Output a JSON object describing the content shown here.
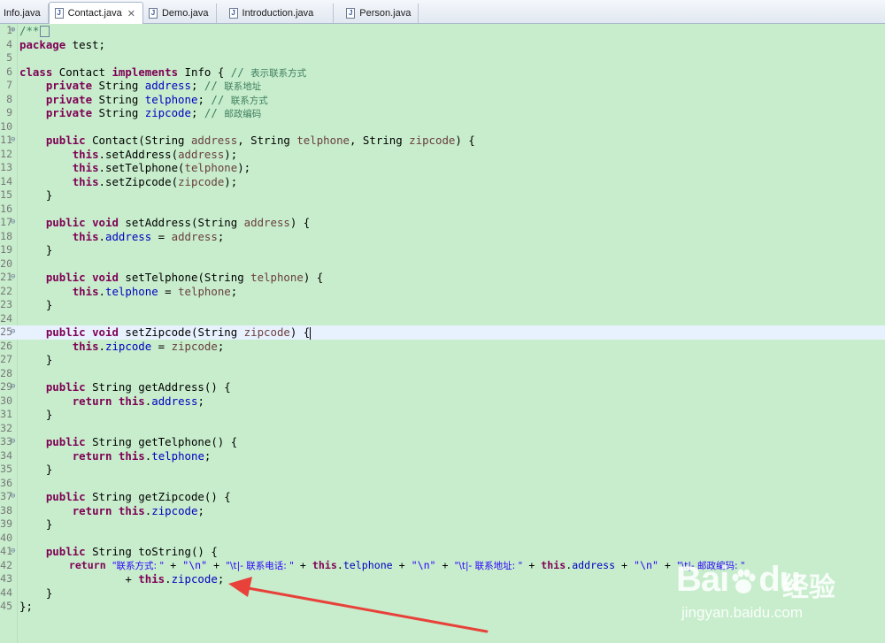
{
  "tabs": [
    {
      "label": "Info.java",
      "active": false
    },
    {
      "label": "Contact.java",
      "active": true,
      "close": "✕"
    },
    {
      "label": "Demo.java",
      "active": false
    },
    {
      "label": "Introduction.java",
      "active": false
    },
    {
      "label": "Person.java",
      "active": false
    }
  ],
  "line_numbers": [
    "1",
    "4",
    "5",
    "6",
    "7",
    "8",
    "9",
    "10",
    "11",
    "12",
    "13",
    "14",
    "15",
    "16",
    "17",
    "18",
    "19",
    "20",
    "21",
    "22",
    "23",
    "24",
    "25",
    "26",
    "27",
    "28",
    "29",
    "30",
    "31",
    "32",
    "33",
    "34",
    "35",
    "36",
    "37",
    "38",
    "39",
    "40",
    "41",
    "42",
    "43",
    "44",
    "45"
  ],
  "code": {
    "l1": "/**",
    "l4_kw": "package",
    "l4_rest": " test;",
    "l6_kw1": "class",
    "l6_t1": " Contact ",
    "l6_kw2": "implements",
    "l6_t2": " Info { ",
    "l6_cm": "// ",
    "l6_cmcn": "表示联系方式",
    "l7_kw": "private",
    "l7_t": " String ",
    "l7_f": "address",
    "l7_e": "; ",
    "l7_cm": "// ",
    "l7_cmcn": "联系地址",
    "l8_kw": "private",
    "l8_t": " String ",
    "l8_f": "telphone",
    "l8_e": "; ",
    "l8_cm": "// ",
    "l8_cmcn": "联系方式",
    "l9_kw": "private",
    "l9_t": " String ",
    "l9_f": "zipcode",
    "l9_e": "; ",
    "l9_cm": "// ",
    "l9_cmcn": "邮政编码",
    "l11_kw": "public",
    "l11_t1": " Contact(String ",
    "l11_p1": "address",
    "l11_t2": ", String ",
    "l11_p2": "telphone",
    "l11_t3": ", String ",
    "l11_p3": "zipcode",
    "l11_t4": ") {",
    "l12_kw": "this",
    "l12_t1": ".setAddress(",
    "l12_p": "address",
    "l12_t2": ");",
    "l13_kw": "this",
    "l13_t1": ".setTelphone(",
    "l13_p": "telphone",
    "l13_t2": ");",
    "l14_kw": "this",
    "l14_t1": ".setZipcode(",
    "l14_p": "zipcode",
    "l14_t2": ");",
    "close": "}",
    "l17_kw1": "public",
    "l17_kw2": "void",
    "l17_t1": " setAddress(String ",
    "l17_p": "address",
    "l17_t2": ") {",
    "l18_kw": "this",
    "l18_d": ".",
    "l18_f": "address",
    "l18_t": " = ",
    "l18_p": "address",
    "l18_e": ";",
    "l21_kw1": "public",
    "l21_kw2": "void",
    "l21_t1": " setTelphone(String ",
    "l21_p": "telphone",
    "l21_t2": ") {",
    "l22_kw": "this",
    "l22_d": ".",
    "l22_f": "telphone",
    "l22_t": " = ",
    "l22_p": "telphone",
    "l22_e": ";",
    "l25_kw1": "public",
    "l25_kw2": "void",
    "l25_t1": " setZipcode(String ",
    "l25_p": "zipcode",
    "l25_t2": ") {",
    "l26_kw": "this",
    "l26_d": ".",
    "l26_f": "zipcode",
    "l26_t": " = ",
    "l26_p": "zipcode",
    "l26_e": ";",
    "l29_kw": "public",
    "l29_t": " String getAddress() {",
    "l30_kw1": "return",
    "l30_kw2": "this",
    "l30_d": ".",
    "l30_f": "address",
    "l30_e": ";",
    "l33_kw": "public",
    "l33_t": " String getTelphone() {",
    "l34_kw1": "return",
    "l34_kw2": "this",
    "l34_d": ".",
    "l34_f": "telphone",
    "l34_e": ";",
    "l37_kw": "public",
    "l37_t": " String getZipcode() {",
    "l38_kw1": "return",
    "l38_kw2": "this",
    "l38_d": ".",
    "l38_f": "zipcode",
    "l38_e": ";",
    "l41_kw": "public",
    "l41_t": " String toString() {",
    "l42_kw1": "return",
    "l42_s1": "\"联系方式: \"",
    "l42_o1": " + ",
    "l42_s2": "\"\\n\"",
    "l42_o2": " + ",
    "l42_s3": "\"\\t|- 联系电话: \"",
    "l42_o3": " + ",
    "l42_kw2": "this",
    "l42_d1": ".",
    "l42_f1": "telphone",
    "l42_o4": " + ",
    "l42_s4": "\"\\n\"",
    "l42_o5": " + ",
    "l42_s5": "\"\\t|- 联系地址: \"",
    "l42_o6": " + ",
    "l42_kw3": "this",
    "l42_d2": ".",
    "l42_f2": "address",
    "l42_o7": " + ",
    "l42_s6": "\"\\n\"",
    "l42_o8": " + ",
    "l42_s7": "\"\\t|- 邮政编码: \"",
    "l43_o": "+ ",
    "l43_kw": "this",
    "l43_d": ".",
    "l43_f": "zipcode",
    "l43_e": ";",
    "l45": "};"
  },
  "watermark": {
    "logo": "Bai",
    "logo2": "du",
    "cn": "经验",
    "url": "jingyan.baidu.com"
  },
  "colors": {
    "editor_bg": "#c7edcc",
    "keyword": "#7f0055",
    "field": "#0000c0",
    "param": "#6a3e3e",
    "comment": "#3f7f5f",
    "string": "#2a00ff",
    "arrow": "#e8413a"
  }
}
